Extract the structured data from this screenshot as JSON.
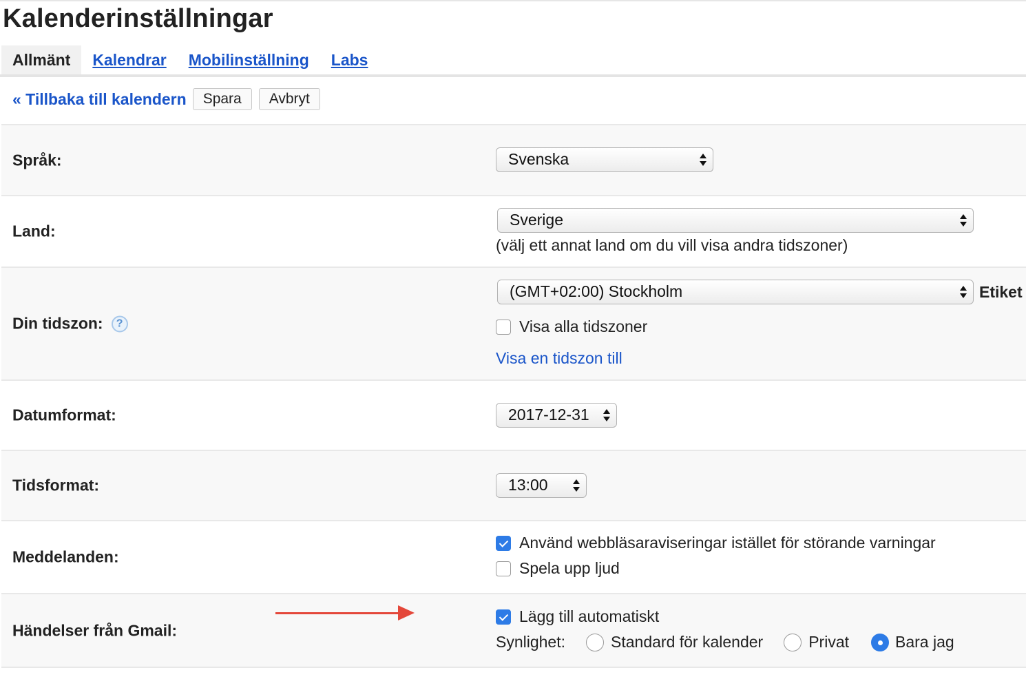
{
  "page": {
    "title": "Kalenderinställningar"
  },
  "tabs": [
    {
      "label": "Allmänt",
      "active": true
    },
    {
      "label": "Kalendrar",
      "active": false
    },
    {
      "label": "Mobilinställning",
      "active": false
    },
    {
      "label": "Labs",
      "active": false
    }
  ],
  "actions": {
    "back_link": "« Tillbaka till kalendern",
    "save": "Spara",
    "cancel": "Avbryt"
  },
  "settings": {
    "language": {
      "label": "Språk:",
      "value": "Svenska"
    },
    "country": {
      "label": "Land:",
      "value": "Sverige",
      "note": "(välj ett annat land om du vill visa andra tidszoner)"
    },
    "timezone": {
      "label": "Din tidszon:",
      "value": "(GMT+02:00) Stockholm",
      "side_label": "Etiket",
      "show_all": {
        "label": "Visa alla tidszoner",
        "checked": false
      },
      "add_link": "Visa en tidszon till"
    },
    "date_format": {
      "label": "Datumformat:",
      "value": "2017-12-31"
    },
    "time_format": {
      "label": "Tidsformat:",
      "value": "13:00"
    },
    "notifications": {
      "label": "Meddelanden:",
      "browser": {
        "label": "Använd webbläsaraviseringar istället för störande varningar",
        "checked": true
      },
      "sound": {
        "label": "Spela upp ljud",
        "checked": false
      }
    },
    "gmail_events": {
      "label": "Händelser från Gmail:",
      "auto_add": {
        "label": "Lägg till automatiskt",
        "checked": true
      },
      "visibility_label": "Synlighet:",
      "visibility_options": [
        {
          "label": "Standard för kalender",
          "selected": false
        },
        {
          "label": "Privat",
          "selected": false
        },
        {
          "label": "Bara jag",
          "selected": true
        }
      ]
    }
  },
  "colors": {
    "link": "#1a55c9",
    "accent": "#2d7be6",
    "annotation_arrow": "#e4473a",
    "row_shade": "#f8f8f8"
  }
}
